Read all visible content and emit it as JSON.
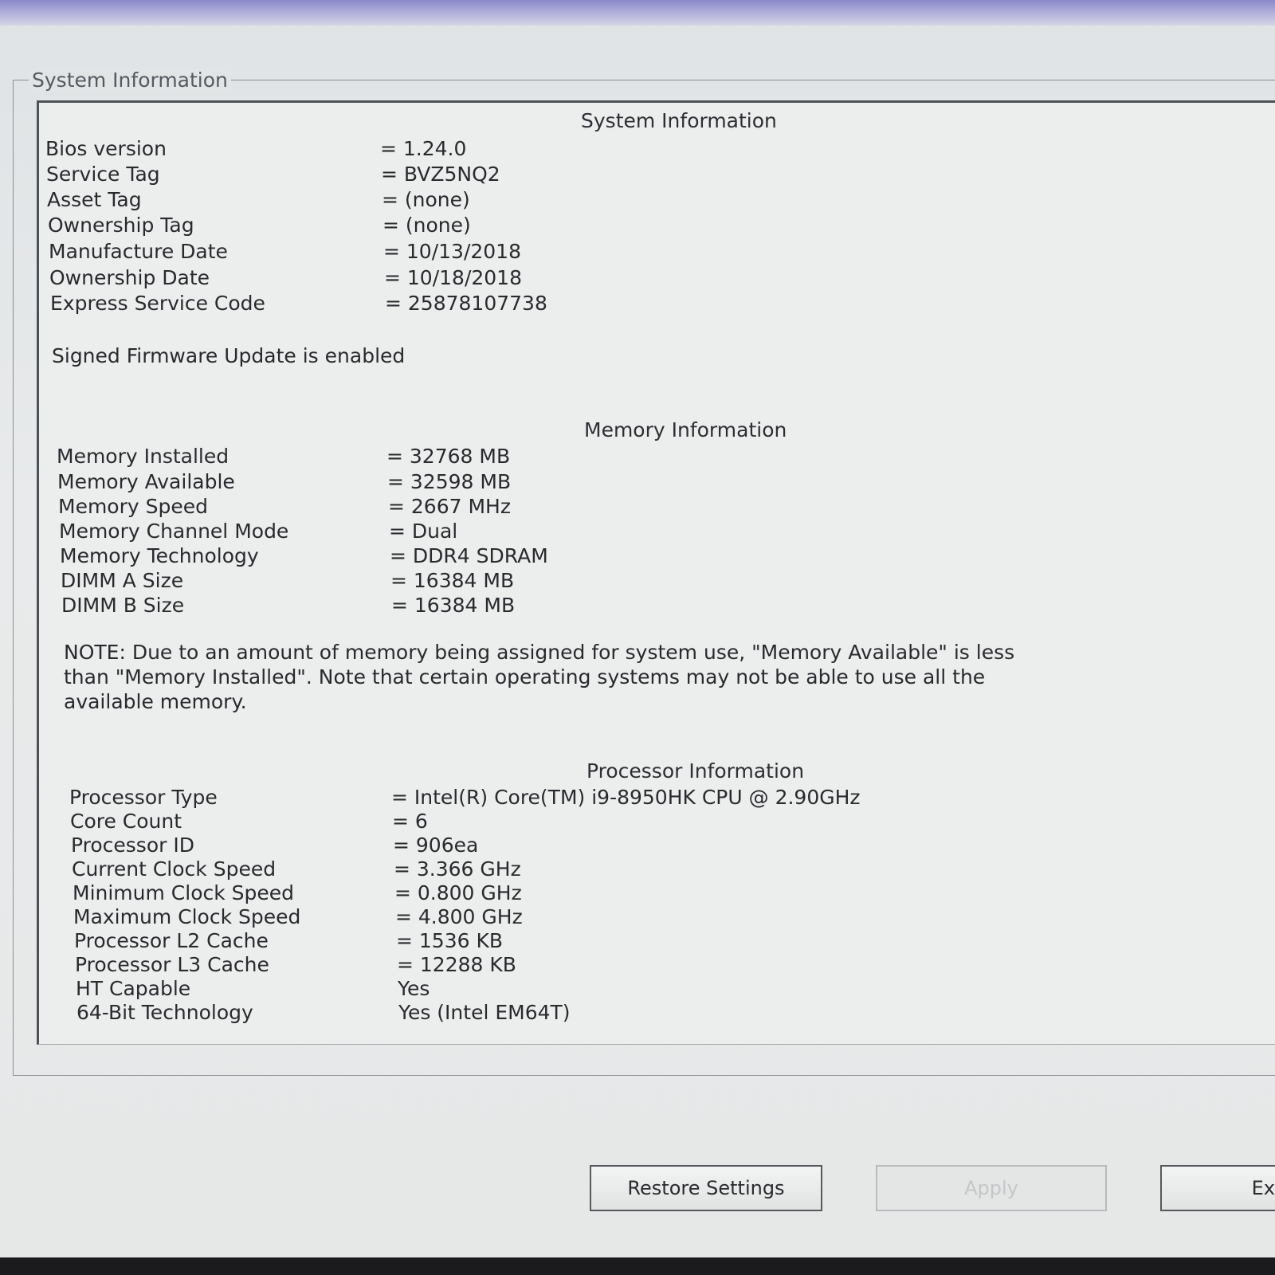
{
  "groupbox_title": "System Information",
  "system": {
    "title": "System Information",
    "rows": [
      {
        "label": "Bios version",
        "value": "= 1.24.0"
      },
      {
        "label": "Service Tag",
        "value": "= BVZ5NQ2"
      },
      {
        "label": "Asset Tag",
        "value": "= (none)"
      },
      {
        "label": "Ownership Tag",
        "value": "= (none)"
      },
      {
        "label": "Manufacture Date",
        "value": "= 10/13/2018"
      },
      {
        "label": "Ownership Date",
        "value": "= 10/18/2018"
      },
      {
        "label": "Express Service Code",
        "value": "= 25878107738"
      }
    ],
    "signed_firmware": "Signed Firmware Update is enabled"
  },
  "memory": {
    "title": "Memory Information",
    "rows": [
      {
        "label": "Memory Installed",
        "value": "= 32768 MB"
      },
      {
        "label": "Memory Available",
        "value": "= 32598 MB"
      },
      {
        "label": "Memory Speed",
        "value": "= 2667 MHz"
      },
      {
        "label": "Memory Channel Mode",
        "value": "= Dual"
      },
      {
        "label": "Memory Technology",
        "value": "= DDR4 SDRAM"
      },
      {
        "label": "DIMM A Size",
        "value": "= 16384 MB"
      },
      {
        "label": "DIMM B Size",
        "value": "= 16384 MB"
      }
    ],
    "note_lines": [
      "NOTE: Due to an amount of memory being assigned for system use, \"Memory Available\" is less",
      "than \"Memory Installed\". Note that certain operating systems may not be able to use all the",
      "available memory."
    ]
  },
  "processor": {
    "title": "Processor Information",
    "rows": [
      {
        "label": "Processor Type",
        "value": "= Intel(R) Core(TM) i9-8950HK CPU @ 2.90GHz"
      },
      {
        "label": "Core Count",
        "value": "= 6"
      },
      {
        "label": "Processor ID",
        "value": "= 906ea"
      },
      {
        "label": "Current Clock Speed",
        "value": "= 3.366 GHz"
      },
      {
        "label": "Minimum Clock Speed",
        "value": "= 0.800 GHz"
      },
      {
        "label": "Maximum Clock Speed",
        "value": "= 4.800 GHz"
      },
      {
        "label": "Processor L2 Cache",
        "value": "= 1536 KB"
      },
      {
        "label": "Processor L3 Cache",
        "value": "= 12288 KB"
      },
      {
        "label": "HT Capable",
        "value": "Yes"
      },
      {
        "label": "64-Bit Technology",
        "value": "Yes (Intel EM64T)"
      }
    ]
  },
  "buttons": {
    "restore": "Restore Settings",
    "apply": "Apply",
    "exit_partial": "Ex"
  }
}
